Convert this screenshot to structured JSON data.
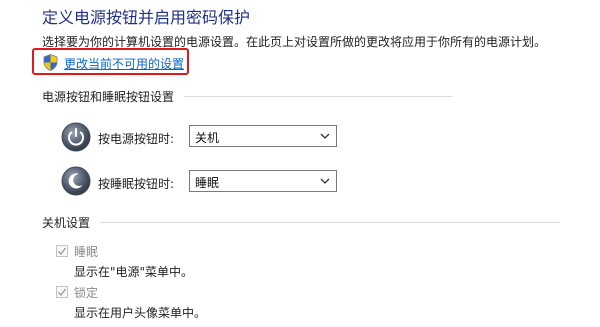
{
  "page": {
    "title": "定义电源按钮并启用密码保护",
    "description": "选择要为你的计算机设置的电源设置。在此页上对设置所做的更改将应用于你所有的电源计划。",
    "change_settings_link": "更改当前不可用的设置"
  },
  "power_buttons_section": {
    "header": "电源按钮和睡眠按钮设置",
    "power_button": {
      "label": "按电源按钮时:",
      "value": "关机"
    },
    "sleep_button": {
      "label": "按睡眠按钮时:",
      "value": "睡眠"
    }
  },
  "shutdown_section": {
    "header": "关机设置",
    "items": [
      {
        "label": "睡眠",
        "description": "显示在\"电源\"菜单中。",
        "checked": true,
        "disabled": true
      },
      {
        "label": "锁定",
        "description": "显示在用户头像菜单中。",
        "checked": true,
        "disabled": true
      }
    ]
  },
  "colors": {
    "title": "#1e3287",
    "link": "#0c65c6",
    "highlight_box": "#e0191c"
  },
  "icons": [
    "shield-icon",
    "power-button-icon",
    "sleep-button-icon",
    "chevron-down-icon",
    "checkmark-icon"
  ]
}
